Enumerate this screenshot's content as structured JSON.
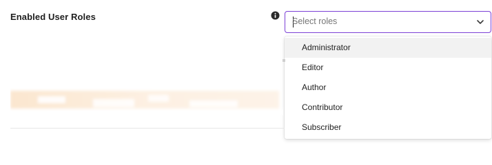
{
  "field": {
    "label": "Enabled User Roles",
    "info_icon": "info-circle-icon"
  },
  "select": {
    "placeholder": "Select roles",
    "value": "",
    "chevron_icon": "chevron-down-icon",
    "focused": true,
    "accent_color": "#7b3fd6"
  },
  "dropdown": {
    "open": true,
    "hovered_option": "Administrator",
    "options": [
      {
        "label": "Administrator"
      },
      {
        "label": "Editor"
      },
      {
        "label": "Author"
      },
      {
        "label": "Contributor"
      },
      {
        "label": "Subscriber"
      }
    ]
  }
}
